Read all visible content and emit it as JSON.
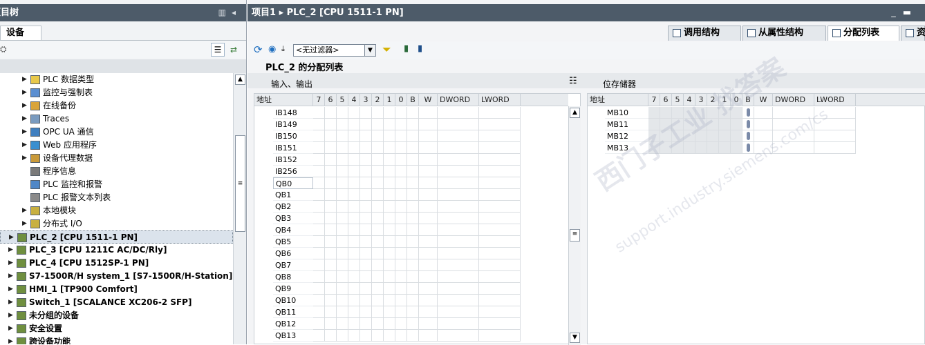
{
  "left_pane": {
    "title": "项目树",
    "tab_label": "设备",
    "tree_items": [
      {
        "label": "PLC 数据类型",
        "level": 2,
        "expandable": true
      },
      {
        "label": "监控与强制表",
        "level": 2,
        "expandable": true
      },
      {
        "label": "在线备份",
        "level": 2,
        "expandable": true
      },
      {
        "label": "Traces",
        "level": 2,
        "expandable": true
      },
      {
        "label": "OPC UA 通信",
        "level": 2,
        "expandable": true
      },
      {
        "label": "Web 应用程序",
        "level": 2,
        "expandable": true
      },
      {
        "label": "设备代理数据",
        "level": 2,
        "expandable": true
      },
      {
        "label": "程序信息",
        "level": 2,
        "expandable": false
      },
      {
        "label": "PLC 监控和报警",
        "level": 2,
        "expandable": false
      },
      {
        "label": "PLC 报警文本列表",
        "level": 2,
        "expandable": false
      },
      {
        "label": "本地模块",
        "level": 2,
        "expandable": true
      },
      {
        "label": "分布式 I/O",
        "level": 2,
        "expandable": true
      },
      {
        "label": "PLC_2 [CPU 1511-1 PN]",
        "level": 1,
        "expandable": true,
        "selected": true
      },
      {
        "label": "PLC_3 [CPU 1211C AC/DC/Rly]",
        "level": 1,
        "expandable": true
      },
      {
        "label": "PLC_4 [CPU 1512SP-1 PN]",
        "level": 1,
        "expandable": true
      },
      {
        "label": "S7-1500R/H system_1 [S7-1500R/H-Station]",
        "level": 1,
        "expandable": true
      },
      {
        "label": "HMI_1 [TP900 Comfort]",
        "level": 1,
        "expandable": true
      },
      {
        "label": "Switch_1 [SCALANCE XC206-2 SFP]",
        "level": 1,
        "expandable": true
      },
      {
        "label": "未分组的设备",
        "level": 1,
        "expandable": true
      },
      {
        "label": "安全设置",
        "level": 1,
        "expandable": true
      },
      {
        "label": "跨设备功能",
        "level": 1,
        "expandable": true
      }
    ]
  },
  "right_pane": {
    "title": "项目1 ▸ PLC_2 [CPU 1511-1 PN]",
    "view_tabs": [
      "调用结构",
      "从属性结构",
      "分配列表",
      "资"
    ],
    "active_tab": "分配列表",
    "filter_value": "<无过滤器>",
    "page_title": "PLC_2 的分配列表",
    "io_section_label": "输入、输出",
    "memory_section_label": "位存储器",
    "columns": [
      "地址",
      "7",
      "6",
      "5",
      "4",
      "3",
      "2",
      "1",
      "0",
      "B",
      "W",
      "DWORD",
      "LWORD"
    ],
    "io_rows": [
      "IB148",
      "IB149",
      "IB150",
      "IB151",
      "IB152",
      "IB256",
      "QB0",
      "QB1",
      "QB2",
      "QB3",
      "QB4",
      "QB5",
      "QB6",
      "QB7",
      "QB8",
      "QB9",
      "QB10",
      "QB11",
      "QB12",
      "QB13"
    ],
    "memory_rows": [
      "MB10",
      "MB11",
      "MB12",
      "MB13"
    ],
    "watermark_main": "西门子工业 找答案",
    "watermark_sub": "support.industry.siemens.com/cs"
  }
}
